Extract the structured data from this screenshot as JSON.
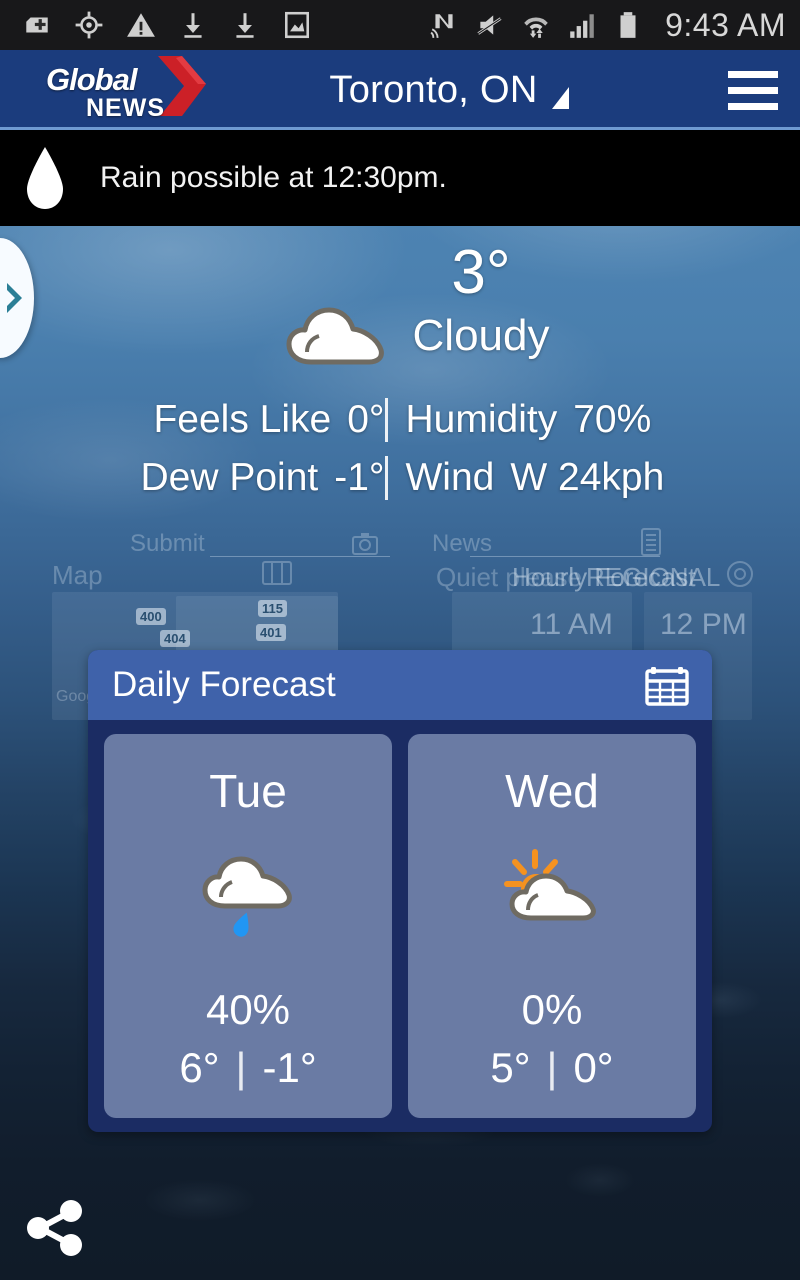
{
  "status_bar": {
    "time": "9:43 AM",
    "left_icons": [
      {
        "name": "sd-card-add-icon"
      },
      {
        "name": "gps-location-icon"
      },
      {
        "name": "warning-triangle-icon"
      },
      {
        "name": "download-icon"
      },
      {
        "name": "download-icon"
      },
      {
        "name": "screenshot-image-icon"
      }
    ],
    "right_icons": [
      {
        "name": "nfc-icon"
      },
      {
        "name": "volume-muted-icon"
      },
      {
        "name": "wifi-data-icon"
      },
      {
        "name": "cellular-signal-icon"
      },
      {
        "name": "battery-icon"
      }
    ]
  },
  "header": {
    "brand_primary": "Global",
    "brand_secondary": "NEWS",
    "location": "Toronto, ON",
    "menu_label": "Menu",
    "brand_blue": "#1b3c7d",
    "brand_red": "#cc2027"
  },
  "alert": {
    "icon": "raindrop-icon",
    "text": "Rain possible at 12:30pm."
  },
  "nav": {
    "next_label": "Next"
  },
  "current": {
    "icon": "cloudy-icon",
    "temperature": "3°",
    "condition": "Cloudy",
    "stats": [
      {
        "label": "Feels Like",
        "value": "0°"
      },
      {
        "label": "Humidity",
        "value": "70%"
      },
      {
        "label": "Dew Point",
        "value": "-1°"
      },
      {
        "label": "Wind",
        "value": "W 24kph"
      }
    ]
  },
  "background_cards": {
    "submit_label": "Submit",
    "news_label": "News",
    "map_label": "Map",
    "quiet_label": "Quiet please",
    "hourly_label": "Hourly Forecast",
    "regional_label": "REGIONAL",
    "hours": [
      "11 AM",
      "12 PM"
    ],
    "road_shields": [
      "400",
      "115",
      "404",
      "401"
    ]
  },
  "daily_forecast": {
    "title": "Daily Forecast",
    "calendar_icon": "calendar-icon",
    "days": [
      {
        "day": "Tue",
        "icon": "cloudy-rain-icon",
        "precip": "40%",
        "high": "6°",
        "separator": "|",
        "low": "-1°"
      },
      {
        "day": "Wed",
        "icon": "partly-sunny-icon",
        "precip": "0%",
        "high": "5°",
        "separator": "|",
        "low": "0°"
      }
    ]
  },
  "footer": {
    "share_label": "Share"
  }
}
